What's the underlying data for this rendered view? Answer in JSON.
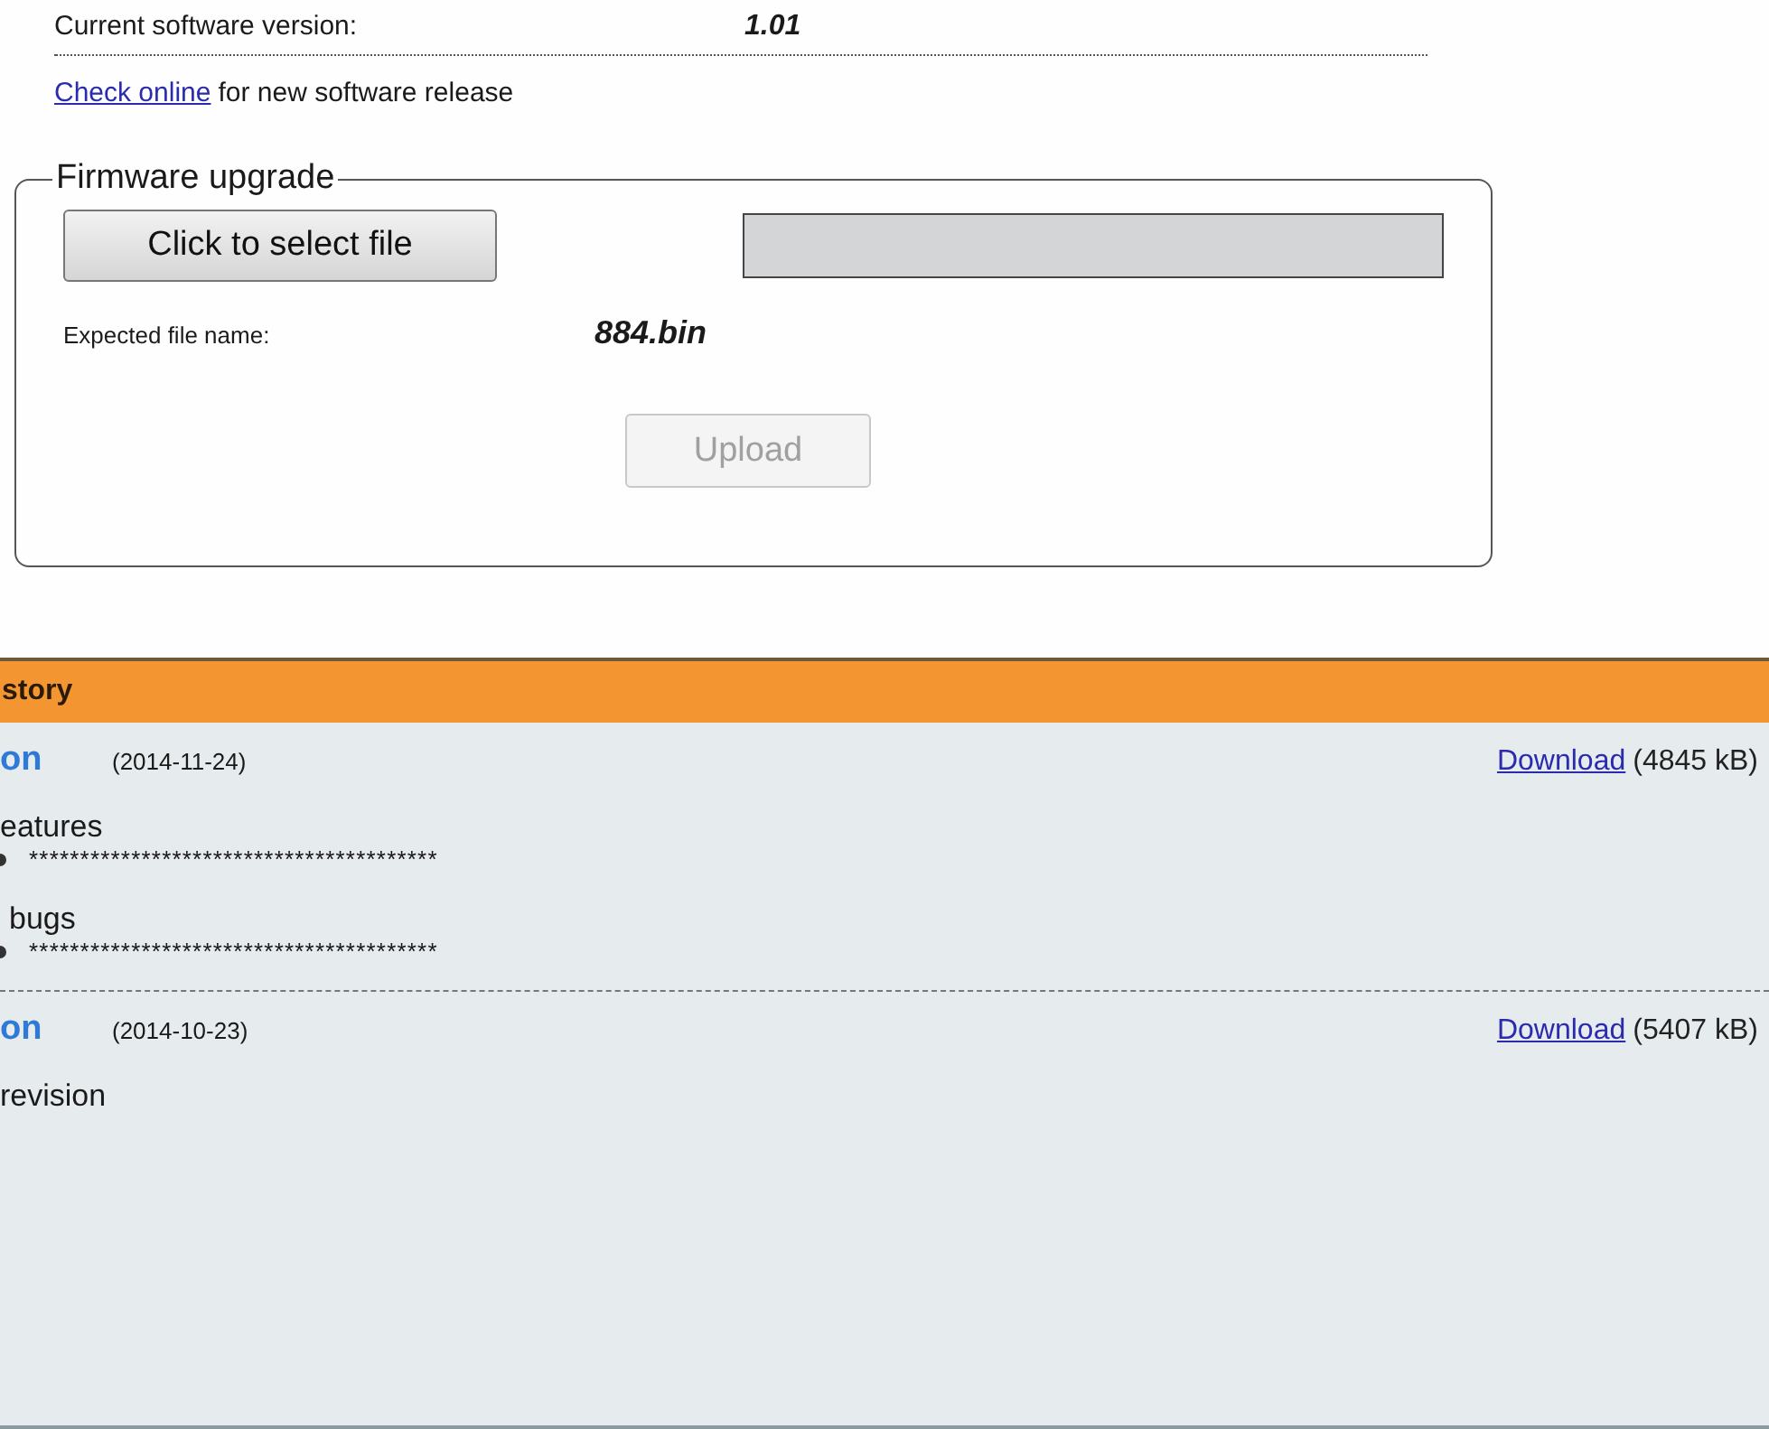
{
  "version": {
    "label": "Current software version:",
    "value": "1.01"
  },
  "check": {
    "link": "Check online",
    "text": "for new software release"
  },
  "firmware": {
    "legend": "Firmware upgrade",
    "select_button": "Click to select file",
    "expected_label": "Expected file name:",
    "expected_value": "884.bin",
    "upload_button": {
      "label": "Upload",
      "disabled": true
    }
  },
  "history": {
    "title": "story",
    "releases": [
      {
        "title": "on",
        "date": "(2014-11-24)",
        "link": "Download",
        "size": "(4845 kB)",
        "sections": [
          {
            "heading": "eatures",
            "items": [
              "****************************************"
            ]
          },
          {
            "heading": "bugs",
            "items": [
              "****************************************"
            ]
          }
        ]
      },
      {
        "title": "on",
        "date": "(2014-10-23)",
        "link": "Download",
        "size": "(5407 kB)",
        "sections": [
          {
            "heading": "revision"
          }
        ]
      }
    ]
  }
}
